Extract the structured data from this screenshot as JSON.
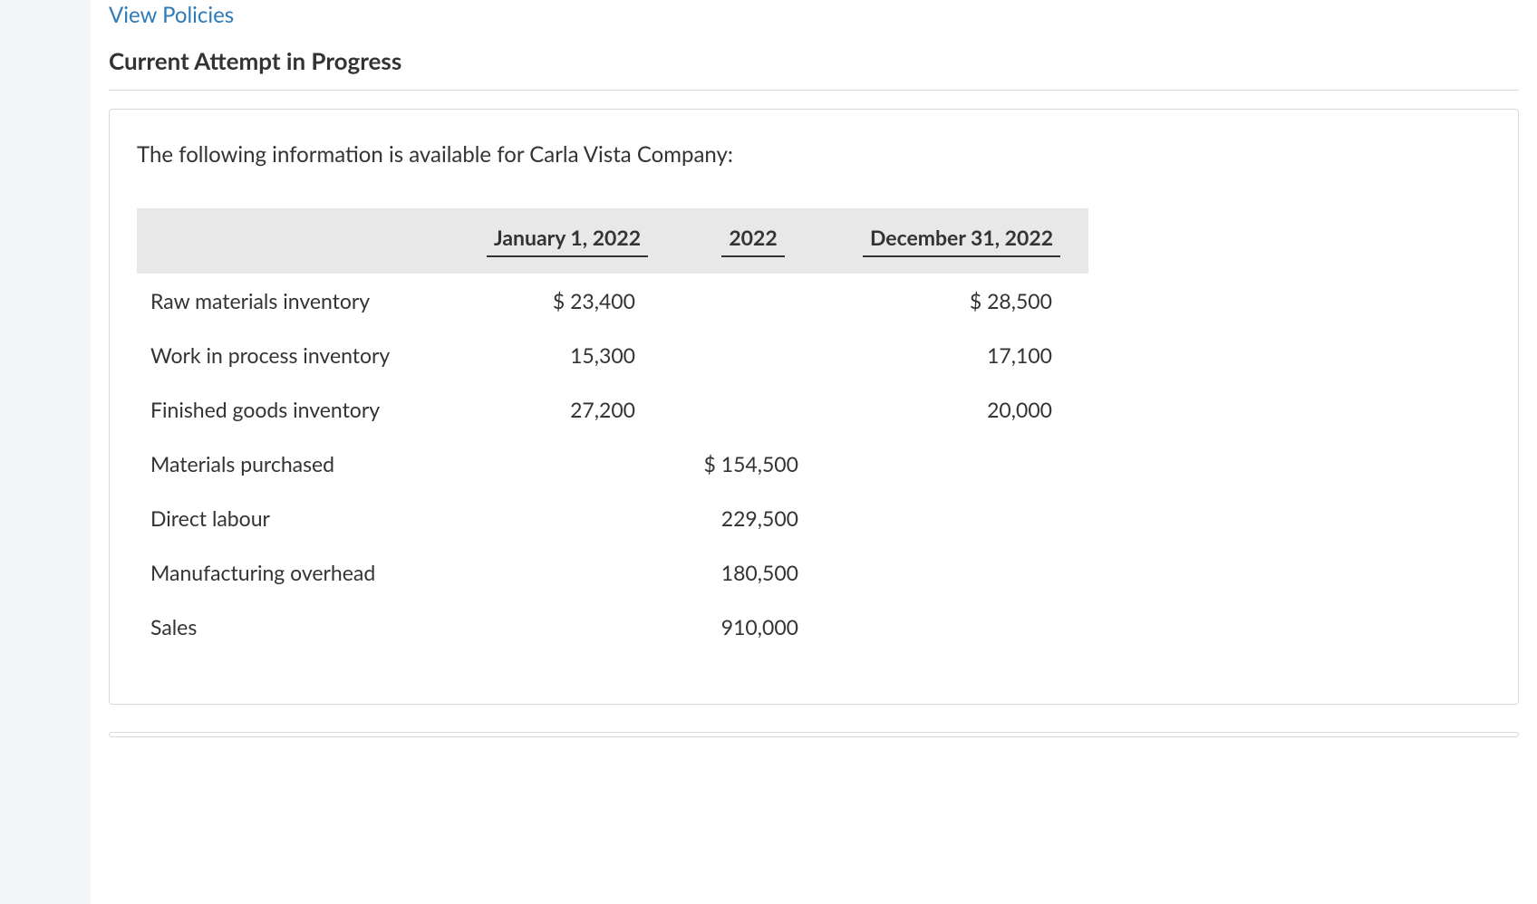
{
  "header": {
    "view_policies": "View Policies",
    "attempt_title": "Current Attempt in Progress"
  },
  "question": {
    "prompt": "The following information is available for Carla Vista Company:"
  },
  "table": {
    "headers": {
      "col1": "January 1, 2022",
      "col2": "2022",
      "col3": "December 31, 2022"
    },
    "rows": [
      {
        "label": "Raw materials inventory",
        "c1": "$ 23,400",
        "c2": "",
        "c3": "$ 28,500"
      },
      {
        "label": "Work in process inventory",
        "c1": "15,300",
        "c2": "",
        "c3": "17,100"
      },
      {
        "label": "Finished goods inventory",
        "c1": "27,200",
        "c2": "",
        "c3": "20,000"
      },
      {
        "label": "Materials purchased",
        "c1": "",
        "c2": "$ 154,500",
        "c3": ""
      },
      {
        "label": "Direct labour",
        "c1": "",
        "c2": "229,500",
        "c3": ""
      },
      {
        "label": "Manufacturing overhead",
        "c1": "",
        "c2": "180,500",
        "c3": ""
      },
      {
        "label": "Sales",
        "c1": "",
        "c2": "910,000",
        "c3": ""
      }
    ]
  }
}
